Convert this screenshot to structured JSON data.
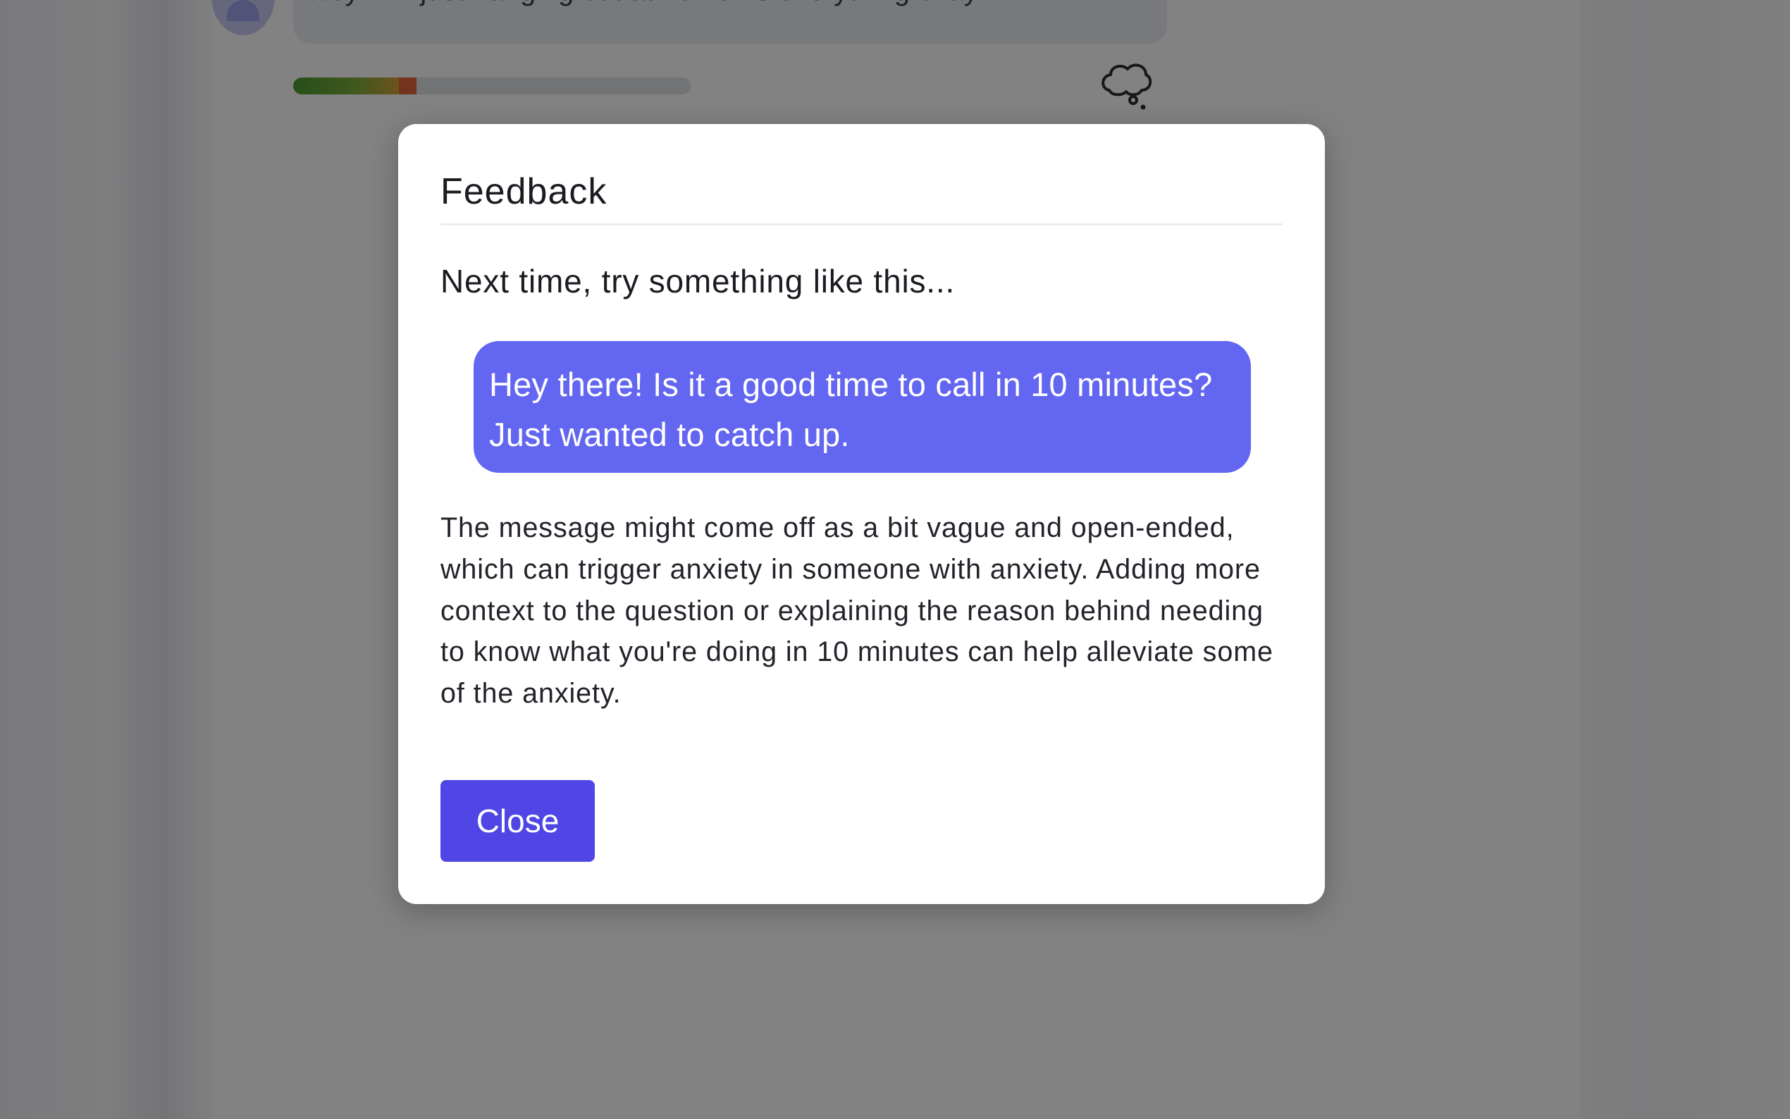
{
  "chat": {
    "incoming_message": "Hey! I'm just hanging out at home. Is everything okay?",
    "tone_meter_fraction": 0.31,
    "thought_icon": "thought-bubble-icon"
  },
  "modal": {
    "title": "Feedback",
    "subtitle": "Next time, try something like this...",
    "suggestion": "Hey there! Is it a good time to call in 10 minutes? Just wanted to catch up.",
    "explanation": "The message might come off as a bit vague and open-ended, which can trigger anxiety in someone with anxiety. Adding more context to the question or explaining the reason behind needing to know what you're doing in 10 minutes can help alleviate some of the anxiety.",
    "close_label": "Close"
  },
  "colors": {
    "overlay": "#000000",
    "accent_button": "#4f46e5",
    "suggestion_bubble": "#6366f1"
  }
}
